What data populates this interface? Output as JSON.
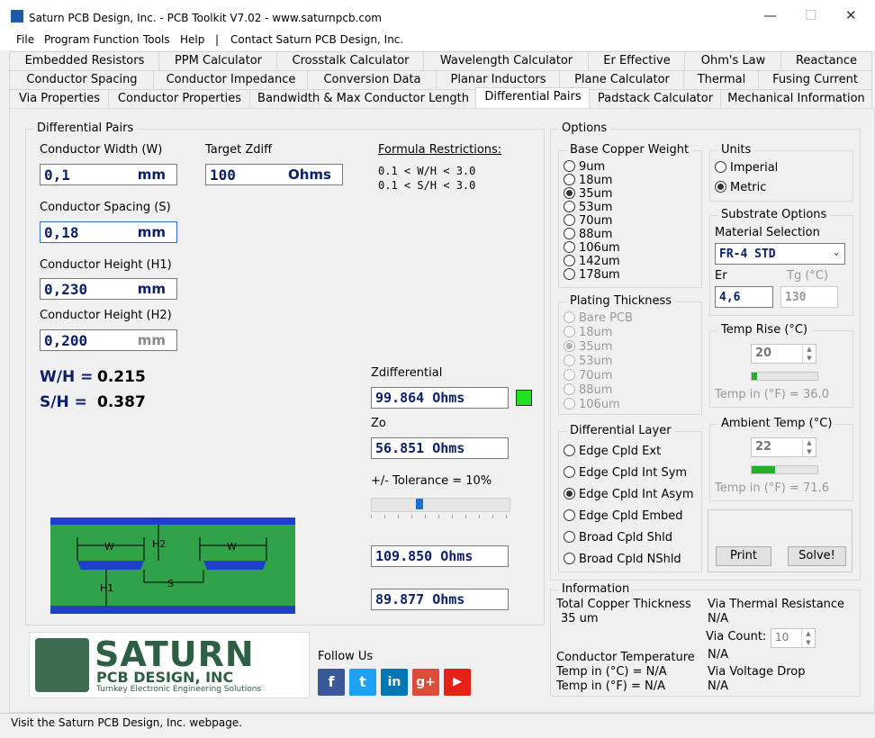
{
  "window": {
    "title": "Saturn PCB Design, Inc. - PCB Toolkit V7.02 - www.saturnpcb.com",
    "minimize": "—",
    "maximize": "☐",
    "close": "✕"
  },
  "menu": {
    "file": "File",
    "program_function": "Program Function",
    "tools": "Tools",
    "help": "Help",
    "separator": "|",
    "contact": "Contact Saturn PCB Design, Inc."
  },
  "tabs": {
    "row1": [
      "Embedded Resistors",
      "PPM Calculator",
      "Crosstalk Calculator",
      "Wavelength Calculator",
      "Er Effective",
      "Ohm's Law",
      "Reactance"
    ],
    "row2": [
      "Conductor Spacing",
      "Conductor Impedance",
      "Conversion Data",
      "Planar Inductors",
      "Plane Calculator",
      "Thermal",
      "Fusing Current"
    ],
    "row3": [
      "Via Properties",
      "Conductor Properties",
      "Bandwidth & Max Conductor Length",
      "Differential Pairs",
      "Padstack Calculator",
      "Mechanical Information"
    ]
  },
  "diff": {
    "group_title": "Differential Pairs",
    "width_label": "Conductor Width (W)",
    "width_value": "0,1",
    "width_unit": "mm",
    "target_label": "Target Zdiff",
    "target_value": "100",
    "target_unit": "Ohms",
    "restrict_title": "Formula Restrictions:",
    "restrict_1": "0.1 < W/H < 3.0",
    "restrict_2": "0.1 < S/H < 3.0",
    "spacing_label": "Conductor Spacing (S)",
    "spacing_value": "0,18",
    "spacing_unit": "mm",
    "h1_label": "Conductor Height (H1)",
    "h1_value": "0,230",
    "h1_unit": "mm",
    "h2_label": "Conductor Height (H2)",
    "h2_value": "0,200",
    "h2_unit": "mm",
    "wh_label": "W/H =",
    "wh_value": "0.215",
    "sh_label": "S/H =",
    "sh_value": "0.387",
    "zdiff_label": "Zdifferential",
    "zdiff_value": "99.864 Ohms",
    "zo_label": "Zo",
    "zo_value": "56.851 Ohms",
    "tol_label": "+/-  Tolerance  =  10%",
    "tol_fraction": 0.34,
    "tol_high": "109.850 Ohms",
    "tol_low": "89.877 Ohms",
    "diagram": {
      "w": "W",
      "h2": "H2",
      "h1": "H1",
      "s": "S"
    }
  },
  "options": {
    "title": "Options",
    "copper_title": "Base Copper Weight",
    "copper": [
      "9um",
      "18um",
      "35um",
      "53um",
      "70um",
      "88um",
      "106um",
      "142um",
      "178um"
    ],
    "copper_selected": 2,
    "units_title": "Units",
    "units_imperial": "Imperial",
    "units_metric": "Metric",
    "substrate_title": "Substrate Options",
    "material_label": "Material Selection",
    "material_value": "FR-4 STD",
    "er_label": "Er",
    "er_value": "4,6",
    "tg_label": "Tg (°C)",
    "tg_value": "130",
    "plating_title": "Plating Thickness",
    "plating": [
      "Bare PCB",
      "18um",
      "35um",
      "53um",
      "70um",
      "88um",
      "106um"
    ],
    "plating_selected": 2,
    "temp_rise_title": "Temp Rise (°C)",
    "temp_rise_value": "20",
    "temp_rise_fraction": 0.08,
    "temp_rise_f": "Temp in (°F) = 36.0",
    "ambient_title": "Ambient Temp (°C)",
    "ambient_value": "22",
    "ambient_fraction": 0.35,
    "ambient_f": "Temp in (°F) = 71.6",
    "layer_title": "Differential Layer",
    "layers": [
      "Edge Cpld Ext",
      "Edge Cpld Int Sym",
      "Edge Cpld Int Asym",
      "Edge Cpld Embed",
      "Broad Cpld Shld",
      "Broad Cpld NShld"
    ],
    "layer_selected": 2,
    "print": "Print",
    "solve": "Solve!"
  },
  "info": {
    "title": "Information",
    "copper_thick_label": "Total Copper Thickness",
    "copper_thick_value": "35 um",
    "via_thermal_label": "Via Thermal Resistance",
    "via_thermal_value": "N/A",
    "via_count_label": "Via Count:",
    "via_count_value": "10",
    "via_count_na": "N/A",
    "cond_temp_label": "Conductor Temperature",
    "temp_c": "Temp in (°C) = N/A",
    "temp_f": "Temp in (°F) = N/A",
    "via_voltage_label": "Via Voltage Drop",
    "via_voltage_value": "N/A"
  },
  "logo": {
    "line1": "SATURN",
    "line2": "PCB DESIGN, INC",
    "line3": "Turnkey Electronic Engineering Solutions"
  },
  "follow": "Follow Us",
  "social": {
    "fb": "f",
    "tw": "t",
    "li": "in",
    "gp": "g+",
    "yt": "▶"
  },
  "status": "Visit the Saturn PCB Design, Inc. webpage.",
  "colors": {
    "accent_text": "#0b1f6b",
    "ok_indicator": "#22e022",
    "board_green": "#2fa24a",
    "board_blue": "#1f3fc8"
  }
}
